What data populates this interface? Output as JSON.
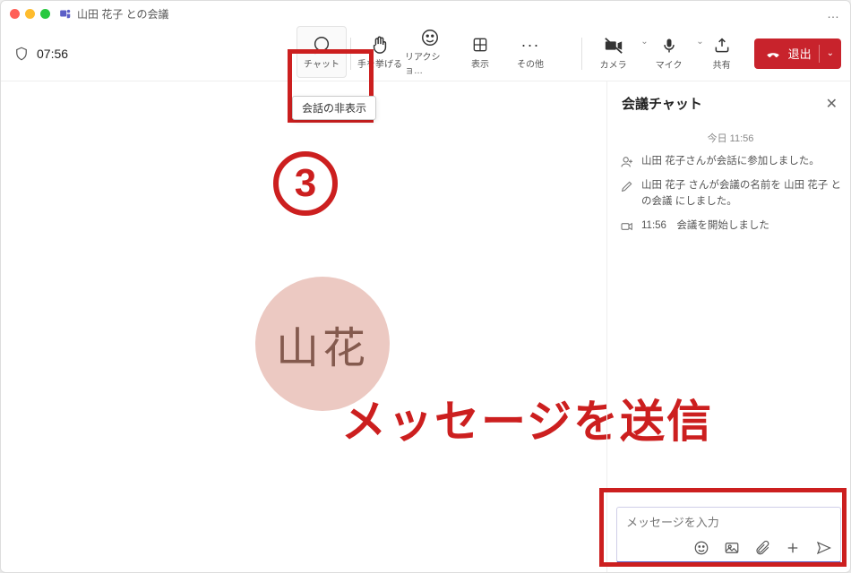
{
  "window": {
    "title": "山田 花子 との会議",
    "more": "…"
  },
  "toolbar": {
    "timer": "07:56",
    "chat": "チャット",
    "raise_hand": "手を挙げる",
    "reaction": "リアクショ…",
    "view": "表示",
    "other": "その他",
    "camera": "カメラ",
    "mic": "マイク",
    "share": "共有",
    "leave": "退出",
    "tooltip_hide_conversation": "会話の非表示"
  },
  "annotations": {
    "step_number": "3",
    "big_text": "メッセージを送信"
  },
  "avatar": {
    "initials": "山花"
  },
  "chat_panel": {
    "title": "会議チャット",
    "timestamp_header": "今日 11:56",
    "events": [
      {
        "icon": "person-add",
        "text": "山田 花子さんが会話に参加しました。"
      },
      {
        "icon": "pencil",
        "text": "山田 花子 さんが会議の名前を 山田 花子 との会議 にしました。"
      },
      {
        "icon": "video",
        "text": "11:56　会議を開始しました"
      }
    ],
    "compose_placeholder": "メッセージを入力"
  }
}
